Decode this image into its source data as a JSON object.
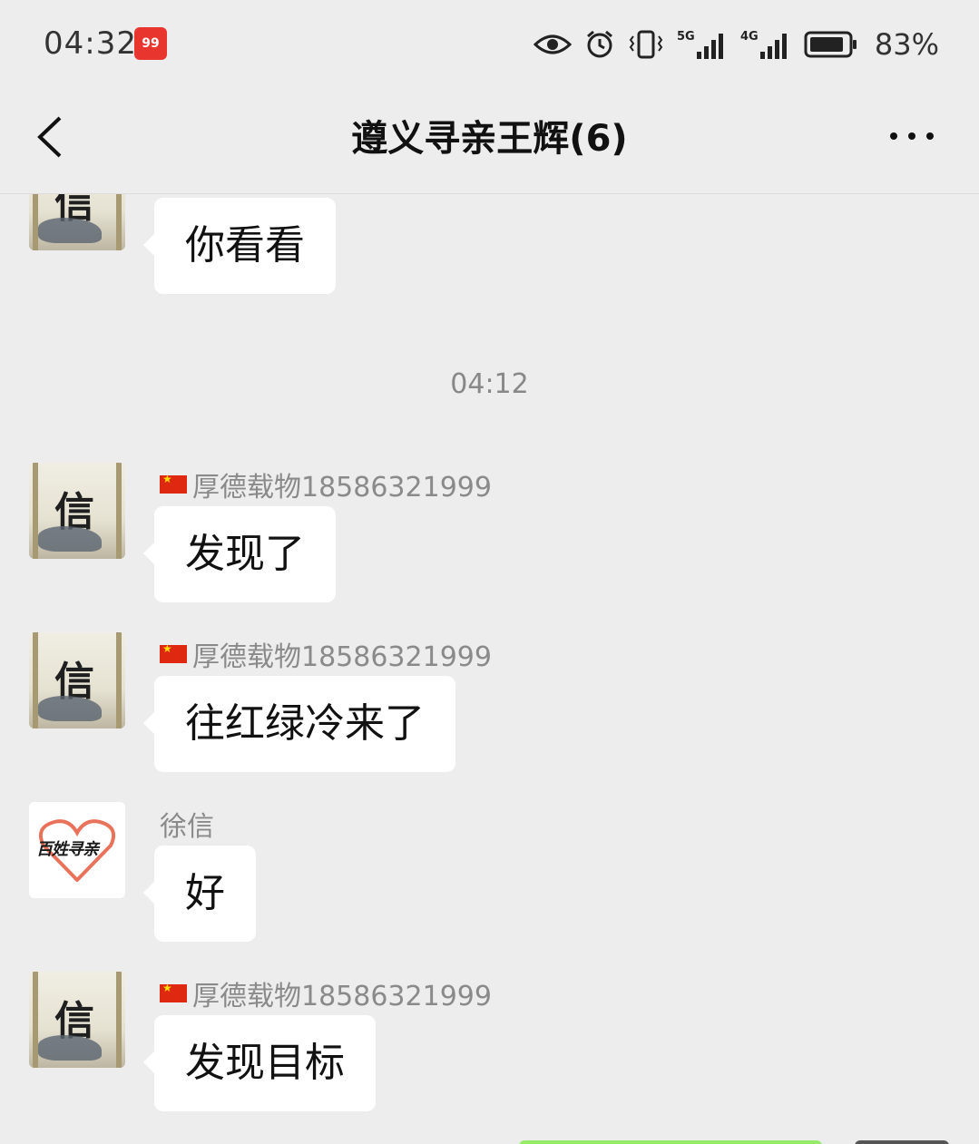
{
  "status": {
    "time": "04:32",
    "battery": "83%",
    "icons": [
      "app-badge-icon",
      "eye-icon",
      "alarm-icon",
      "vibrate-icon",
      "signal-5g-icon",
      "signal-4g-icon",
      "battery-icon"
    ]
  },
  "nav": {
    "title": "遵义寻亲王辉(6)"
  },
  "chat": {
    "messages": [
      {
        "sender": "",
        "text": "你看看"
      },
      {
        "sender": "厚德载物18586321999",
        "text": "发现了"
      },
      {
        "sender": "厚德载物18586321999",
        "text": "往红绿冷来了"
      },
      {
        "sender": "徐信",
        "text": "好"
      },
      {
        "sender": "厚德载物18586321999",
        "text": "发现目标"
      }
    ],
    "timestamp": "04:12",
    "avatar_char": "信",
    "heart_avatar_text": "百姓寻亲"
  },
  "colors": {
    "background": "#ededed",
    "bubble": "#ffffff",
    "self_bubble": "#95ec69",
    "flag_red": "#de2910"
  }
}
